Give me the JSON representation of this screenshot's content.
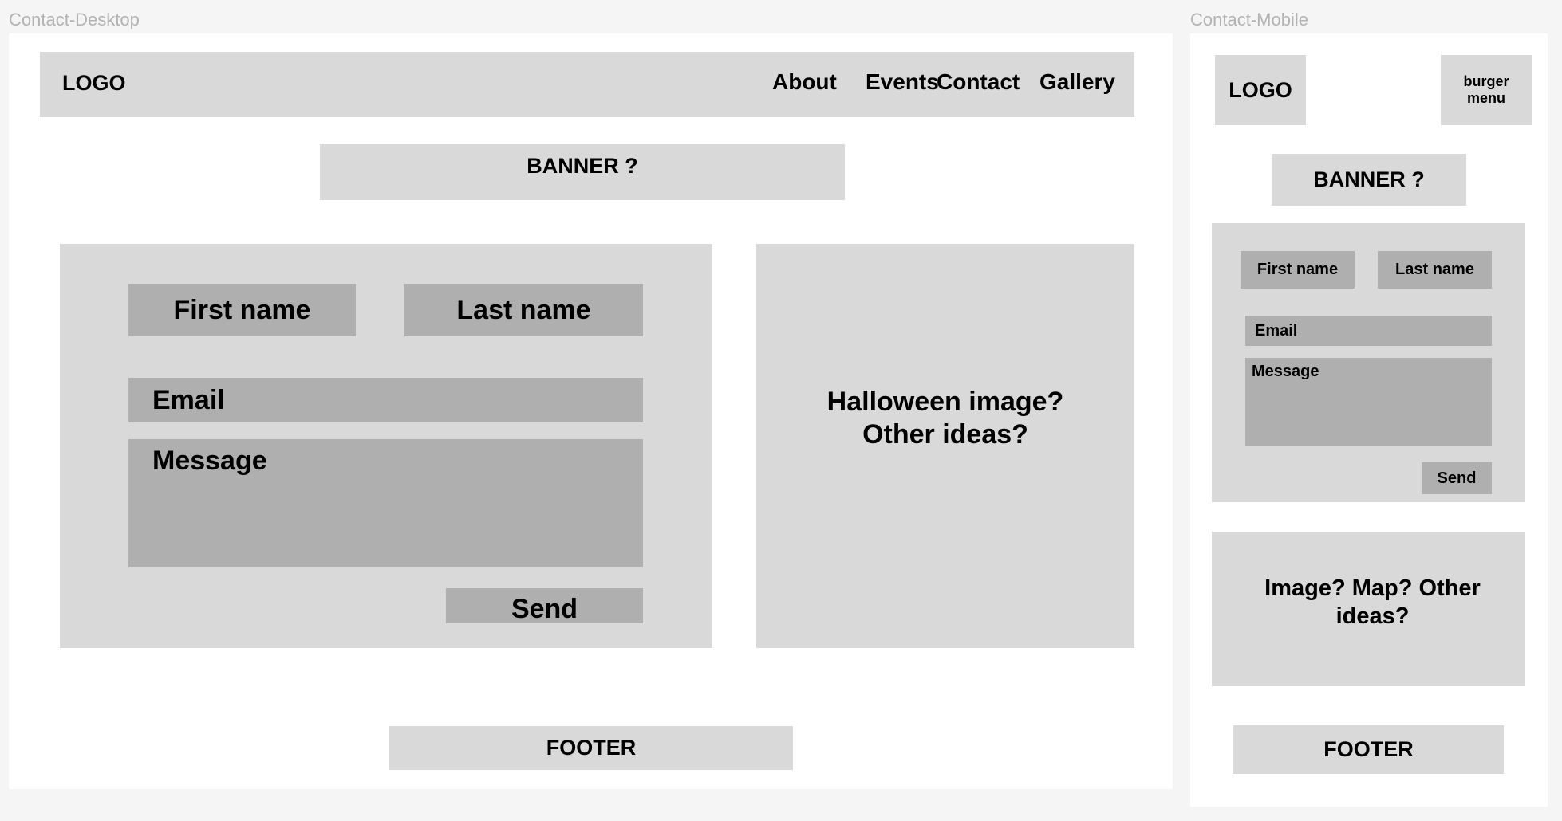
{
  "desktop": {
    "frame_label": "Contact-Desktop",
    "header": {
      "logo": "LOGO",
      "nav": [
        "About",
        "Events",
        "Contact",
        "Gallery"
      ]
    },
    "banner": "BANNER ?",
    "form": {
      "first_name": "First name",
      "last_name": "Last name",
      "email": "Email",
      "message": "Message",
      "send": "Send"
    },
    "side_panel": {
      "line1": "Halloween image?",
      "line2": "Other ideas?"
    },
    "footer": "FOOTER"
  },
  "mobile": {
    "frame_label": "Contact-Mobile",
    "logo": "LOGO",
    "burger_menu": {
      "line1": "burger",
      "line2": "menu"
    },
    "banner": "BANNER ?",
    "form": {
      "first_name": "First name",
      "last_name": "Last name",
      "email": "Email",
      "message": "Message",
      "send": "Send"
    },
    "side_panel": {
      "line1": "Image? Map? Other",
      "line2": "ideas?"
    },
    "footer": "FOOTER"
  }
}
